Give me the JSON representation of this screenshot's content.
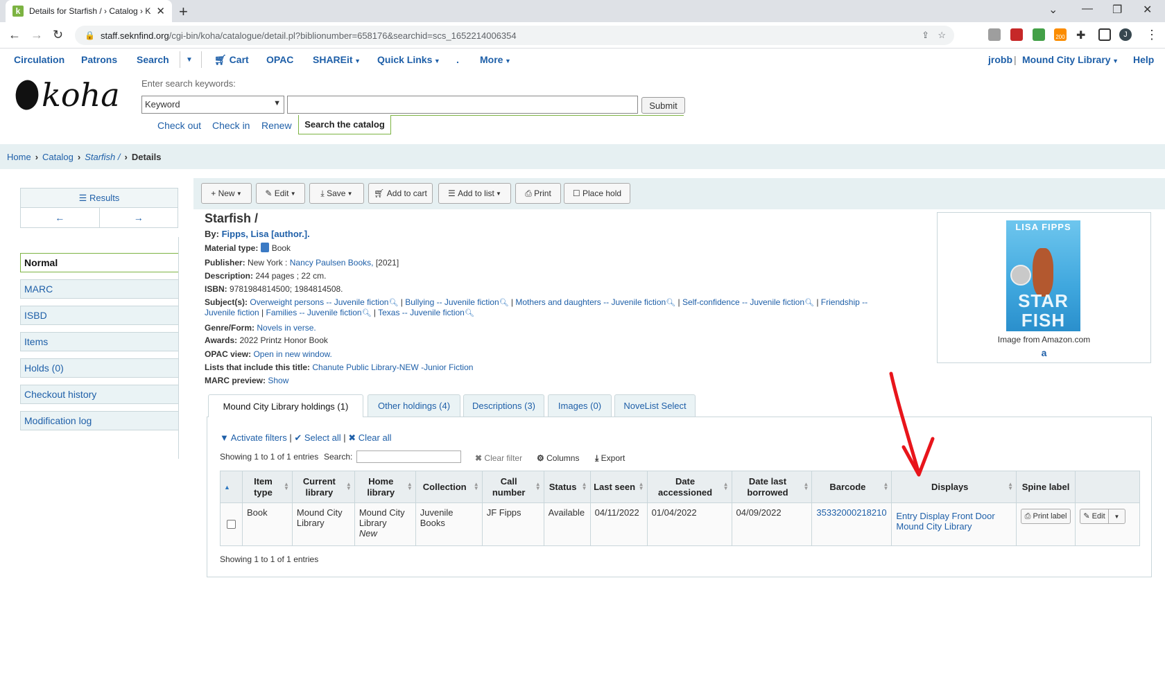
{
  "browser": {
    "tab_title": "Details for Starfish / › Catalog › K",
    "url_host": "staff.seknfind.org",
    "url_path": "/cgi-bin/koha/catalogue/detail.pl?biblionumber=658176&searchid=scs_1652214006354",
    "badge": "200",
    "profile": "J"
  },
  "nav": {
    "items": [
      "Circulation",
      "Patrons",
      "Search",
      "Cart",
      "OPAC",
      "SHAREit",
      "Quick Links",
      ".",
      "More"
    ],
    "user": "jrobb",
    "library": "Mound City Library",
    "help": "Help"
  },
  "logo": "koha",
  "search": {
    "label": "Enter search keywords:",
    "type": "Keyword",
    "submit": "Submit",
    "tabs": [
      "Check out",
      "Check in",
      "Renew"
    ],
    "active_tab": "Search the catalog"
  },
  "breadcrumb": [
    "Home",
    "Catalog",
    "Starfish /",
    "Details"
  ],
  "sidebar": {
    "results": "Results",
    "items": [
      "Normal",
      "MARC",
      "ISBD",
      "Items",
      "Holds (0)",
      "Checkout history",
      "Modification log"
    ]
  },
  "toolbar": [
    "New",
    "Edit",
    "Save",
    "Add to cart",
    "Add to list",
    "Print",
    "Place hold"
  ],
  "record": {
    "title": "Starfish /",
    "by_label": "By:",
    "author": "Fipps, Lisa [author.].",
    "material_label": "Material type:",
    "material": "Book",
    "publisher_label": "Publisher:",
    "publisher_place": "New York :",
    "publisher_name": "Nancy Paulsen Books,",
    "publisher_year": "[2021]",
    "description_label": "Description:",
    "description": "244 pages ; 22 cm.",
    "isbn_label": "ISBN:",
    "isbn": "9781984814500; 1984814508.",
    "subjects_label": "Subject(s):",
    "subjects_line1": [
      "Overweight persons -- Juvenile fiction",
      "Bullying -- Juvenile fiction",
      "Mothers and daughters -- Juvenile fiction",
      "Self-confidence -- Juvenile fiction",
      "Friendship --"
    ],
    "subjects_line2": [
      "Juvenile fiction",
      "Families -- Juvenile fiction",
      "Texas -- Juvenile fiction"
    ],
    "genre_label": "Genre/Form:",
    "genre": "Novels in verse.",
    "awards_label": "Awards:",
    "awards": "2022 Printz Honor Book",
    "opac_label": "OPAC view:",
    "opac": "Open in new window.",
    "lists_label": "Lists that include this title:",
    "lists": "Chanute Public Library-NEW -Junior Fiction",
    "marc_label": "MARC preview:",
    "marc": "Show"
  },
  "cover": {
    "author": "LISA FIPPS",
    "title1": "STAR",
    "title2": "FISH",
    "caption": "Image from Amazon.com",
    "amazon": "a"
  },
  "holdings_tabs": [
    "Mound City Library holdings (1)",
    "Other holdings (4)",
    "Descriptions (3)",
    "Images (0)",
    "NoveList Select"
  ],
  "table_controls": {
    "activate_filters": "Activate filters",
    "select_all": "Select all",
    "clear_all": "Clear all",
    "showing_pre": "Showing",
    "showing_from": "1",
    "to": "to",
    "showing_to": "1",
    "of": "of",
    "total": "1",
    "entries": "entries",
    "search_label": "Search:",
    "clear_filter": "Clear filter",
    "columns": "Columns",
    "export": "Export"
  },
  "table": {
    "headers": [
      "Item type",
      "Current library",
      "Home library",
      "Collection",
      "Call number",
      "Status",
      "Last seen",
      "Date accessioned",
      "Date last borrowed",
      "Barcode",
      "Displays",
      "Spine label"
    ],
    "row": {
      "item_type": "Book",
      "current_library": "Mound City Library",
      "home_library": "Mound City Library",
      "home_library_note": "New",
      "collection": "Juvenile Books",
      "call_number": "JF Fipps",
      "status": "Available",
      "last_seen": "04/11/2022",
      "date_accessioned": "01/04/2022",
      "date_last_borrowed": "04/09/2022",
      "barcode": "35332000218210",
      "displays": "Entry Display Front Door Mound City Library",
      "print_label": "Print label",
      "edit": "Edit"
    }
  },
  "colors": {
    "accent": "#7cb342",
    "link": "#1e5fa8",
    "annotation": "#e8151b"
  }
}
